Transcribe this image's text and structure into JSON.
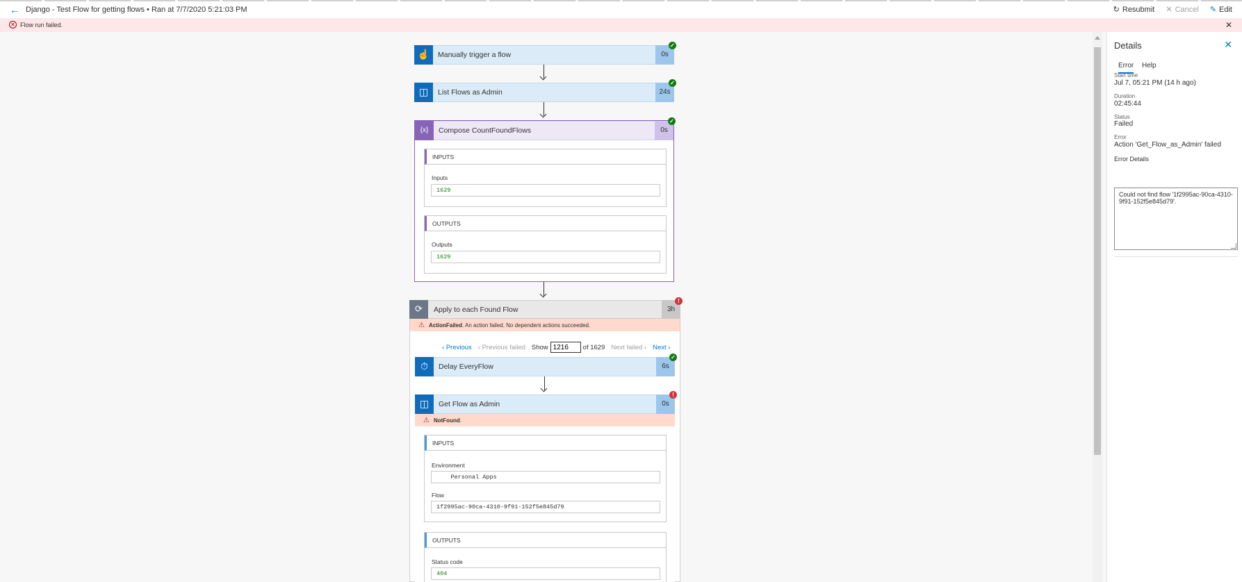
{
  "header": {
    "title": "Django - Test Flow for getting flows • Ran at 7/7/2020 5:21:03 PM",
    "resubmit": "Resubmit",
    "cancel": "Cancel",
    "edit": "Edit"
  },
  "banner": {
    "text": "Flow run failed."
  },
  "steps": {
    "trigger": {
      "name": "Manually trigger a flow",
      "duration": "0s",
      "status": "succeeded"
    },
    "list_flows": {
      "name": "List Flows as Admin",
      "duration": "24s",
      "status": "succeeded"
    },
    "compose": {
      "name": "Compose CountFoundFlows",
      "duration": "0s",
      "status": "succeeded",
      "inputs_header": "INPUTS",
      "inputs_label": "Inputs",
      "inputs_value": "1629",
      "outputs_header": "OUTPUTS",
      "outputs_label": "Outputs",
      "outputs_value": "1629"
    },
    "apply_each": {
      "name": "Apply to each Found Flow",
      "duration": "3h",
      "status": "failed",
      "error_code": "ActionFailed",
      "error_text": ". An action failed. No dependent actions succeeded.",
      "pager": {
        "previous": "Previous",
        "previous_failed": "Previous failed",
        "show_label": "Show",
        "current": "1216",
        "of_label": "of 1629",
        "next_failed": "Next failed",
        "next": "Next"
      }
    },
    "delay": {
      "name": "Delay EveryFlow",
      "duration": "6s",
      "status": "succeeded"
    },
    "get_flow": {
      "name": "Get Flow as Admin",
      "duration": "0s",
      "status": "failed",
      "error_code": "NotFound",
      "error_suffix": ".",
      "inputs_header": "INPUTS",
      "environment_label": "Environment",
      "environment_value": "    Personal Apps",
      "flow_label": "Flow",
      "flow_value": "1f2995ac-90ca-4310-9f91-152f5e845d79",
      "outputs_header": "OUTPUTS",
      "status_code_label": "Status code",
      "status_code_value": "404"
    }
  },
  "details": {
    "title": "Details",
    "tabs": [
      "Error",
      "Help"
    ],
    "start_time_label": "Start time",
    "start_time_value": "Jul 7, 05:21 PM (14 h ago)",
    "duration_label": "Duration",
    "duration_value": "02:45:44",
    "status_label": "Status",
    "status_value": "Failed",
    "error_label": "Error",
    "error_value": "Action 'Get_Flow_as_Admin' failed",
    "error_details_label": "Error Details",
    "error_details_value": "Could not find flow '1f2995ac-90ca-4310-9f91-152f5e845d79'."
  },
  "colors": {
    "accent": "#0078d4",
    "success": "#107c10",
    "failure": "#d13438",
    "banner_bg": "#fde7e9",
    "compose_purple": "#8764b8"
  }
}
